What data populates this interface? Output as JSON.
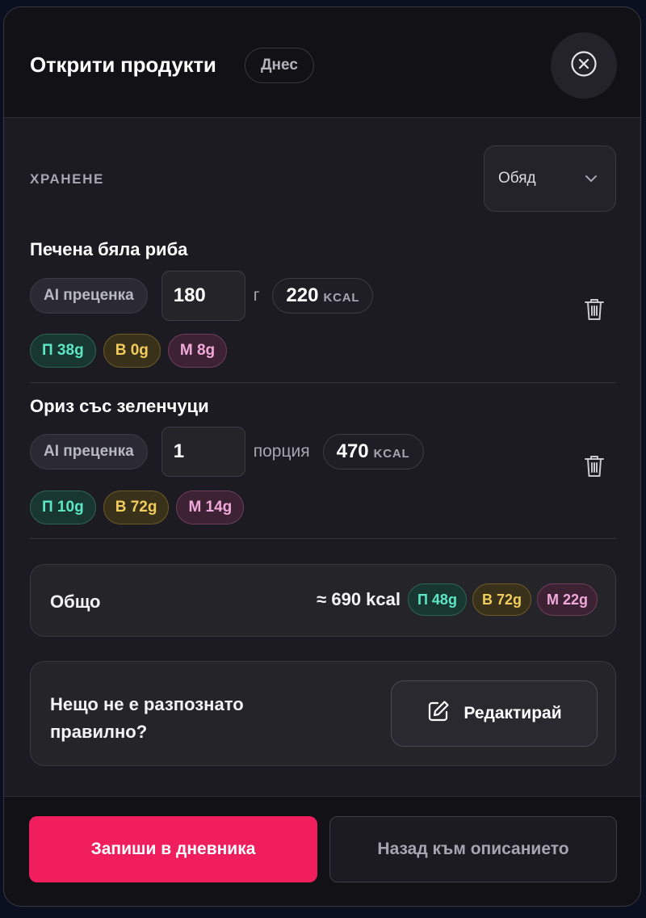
{
  "header": {
    "title": "Открити продукти",
    "date_badge": "Днес",
    "close_icon": "close-circle-icon"
  },
  "meal": {
    "label": "ХРАНЕНЕ",
    "selected": "Обяд",
    "dropdown_icon": "chevron-down-icon"
  },
  "items": [
    {
      "name": "Печена бяла риба",
      "source": "AI преценка",
      "quantity": "180",
      "unit": "г",
      "kcal": "220",
      "kcal_unit": "KCAL",
      "protein": "П 38g",
      "carbs": "В 0g",
      "fat": "М 8g"
    },
    {
      "name": "Ориз със зеленчуци",
      "source": "AI преценка",
      "quantity": "1",
      "unit": "порция",
      "kcal": "470",
      "kcal_unit": "KCAL",
      "protein": "П 10g",
      "carbs": "В 72g",
      "fat": "М 14g"
    }
  ],
  "total": {
    "label": "Общо",
    "kcal": "≈ 690 kcal",
    "protein": "П 48g",
    "carbs": "В 72g",
    "fat": "М 22g"
  },
  "correction": {
    "question": "Нещо не е разпознато правилно?",
    "edit_label": "Редактирай",
    "edit_icon": "pencil-square-icon"
  },
  "footer": {
    "save_label": "Запиши в дневника",
    "back_label": "Назад към описанието"
  },
  "colors": {
    "accent": "#f01e5c",
    "protein": "#5de6c6",
    "carbs": "#f2cc5c",
    "fat": "#f1a9db"
  }
}
